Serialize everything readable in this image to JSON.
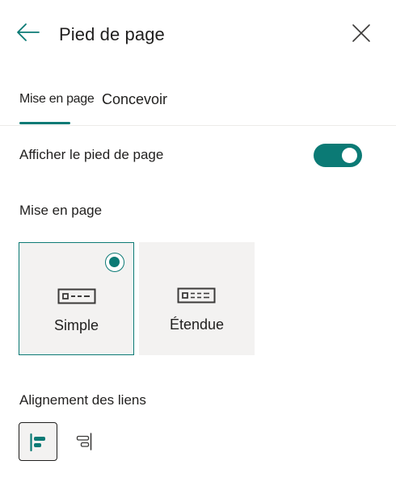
{
  "header": {
    "title": "Pied de page",
    "back_icon": "arrow-left-icon",
    "close_icon": "close-icon"
  },
  "tabs": [
    {
      "label": "Mise en page",
      "active": true
    },
    {
      "label": "Concevoir",
      "active": false
    }
  ],
  "show_footer": {
    "label": "Afficher le pied de page",
    "enabled": true
  },
  "layout": {
    "label": "Mise en page",
    "options": [
      {
        "label": "Simple",
        "icon": "footer-simple-icon",
        "selected": true
      },
      {
        "label": "Étendue",
        "icon": "footer-extended-icon",
        "selected": false
      }
    ]
  },
  "link_alignment": {
    "label": "Alignement des liens",
    "options": [
      {
        "icon": "align-left-icon",
        "selected": true
      },
      {
        "icon": "align-right-icon",
        "selected": false
      }
    ]
  },
  "colors": {
    "accent": "#0b7a75",
    "card_background": "#f3f2f1",
    "text": "#201f1e"
  }
}
